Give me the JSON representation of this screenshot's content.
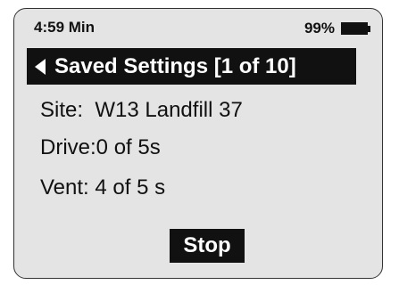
{
  "status": {
    "time": "4:59 Min",
    "battery": "99%"
  },
  "header": {
    "title": "Saved Settings [1 of 10]"
  },
  "info": {
    "site_label": "Site:",
    "site_value": "W13 Landfill 37",
    "drive": "Drive:0 of 5s",
    "vent": "Vent: 4 of 5 s"
  },
  "actions": {
    "stop_label": "Stop"
  }
}
